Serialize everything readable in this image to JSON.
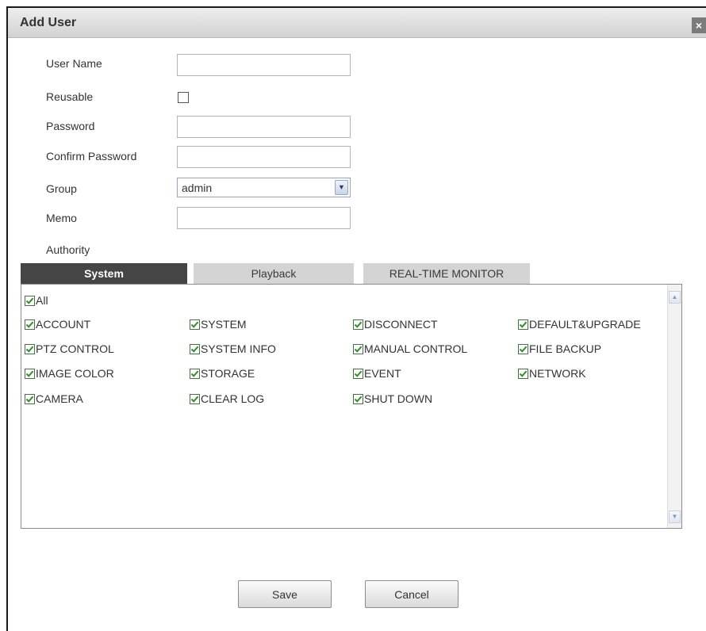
{
  "dialog": {
    "title": "Add User",
    "close_label": "×"
  },
  "form": {
    "user_name_label": "User Name",
    "user_name_value": "",
    "reusable_label": "Reusable",
    "reusable_checked": false,
    "password_label": "Password",
    "password_value": "",
    "confirm_password_label": "Confirm Password",
    "confirm_password_value": "",
    "group_label": "Group",
    "group_value": "admin",
    "memo_label": "Memo",
    "memo_value": "",
    "authority_label": "Authority"
  },
  "tabs": [
    {
      "label": "System",
      "active": true
    },
    {
      "label": "Playback",
      "active": false
    },
    {
      "label": "REAL-TIME MONITOR",
      "active": false
    }
  ],
  "permissions": {
    "all_label": "All",
    "items": [
      [
        "ACCOUNT",
        "SYSTEM",
        "DISCONNECT",
        "DEFAULT&UPGRADE"
      ],
      [
        "PTZ CONTROL",
        "SYSTEM INFO",
        "MANUAL CONTROL",
        "FILE BACKUP"
      ],
      [
        "IMAGE COLOR",
        "STORAGE",
        "EVENT",
        "NETWORK"
      ],
      [
        "CAMERA",
        "CLEAR LOG",
        "SHUT DOWN"
      ]
    ]
  },
  "buttons": {
    "save": "Save",
    "cancel": "Cancel"
  },
  "colors": {
    "check": "#2f8f2f",
    "active_tab": "#454545",
    "inactive_tab": "#d4d4d4",
    "titlebar": "#dcdcdc"
  }
}
